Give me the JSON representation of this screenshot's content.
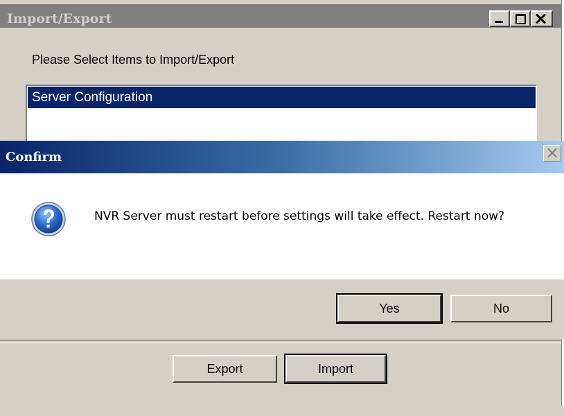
{
  "import_export": {
    "title": "Import/Export",
    "prompt": "Please Select Items to Import/Export",
    "list_items": [
      "Server Configuration"
    ],
    "buttons": {
      "export": "Export",
      "import": "Import"
    }
  },
  "confirm": {
    "title": "Confirm",
    "message": "NVR Server must restart before settings will take effect. Restart now?",
    "icon": "question-icon",
    "buttons": {
      "yes": "Yes",
      "no": "No"
    }
  },
  "colors": {
    "title_active_start": "#0a246a",
    "title_active_end": "#a6caf0",
    "title_inactive": "#808080",
    "selection": "#0a246a",
    "face": "#d4d0c8"
  }
}
